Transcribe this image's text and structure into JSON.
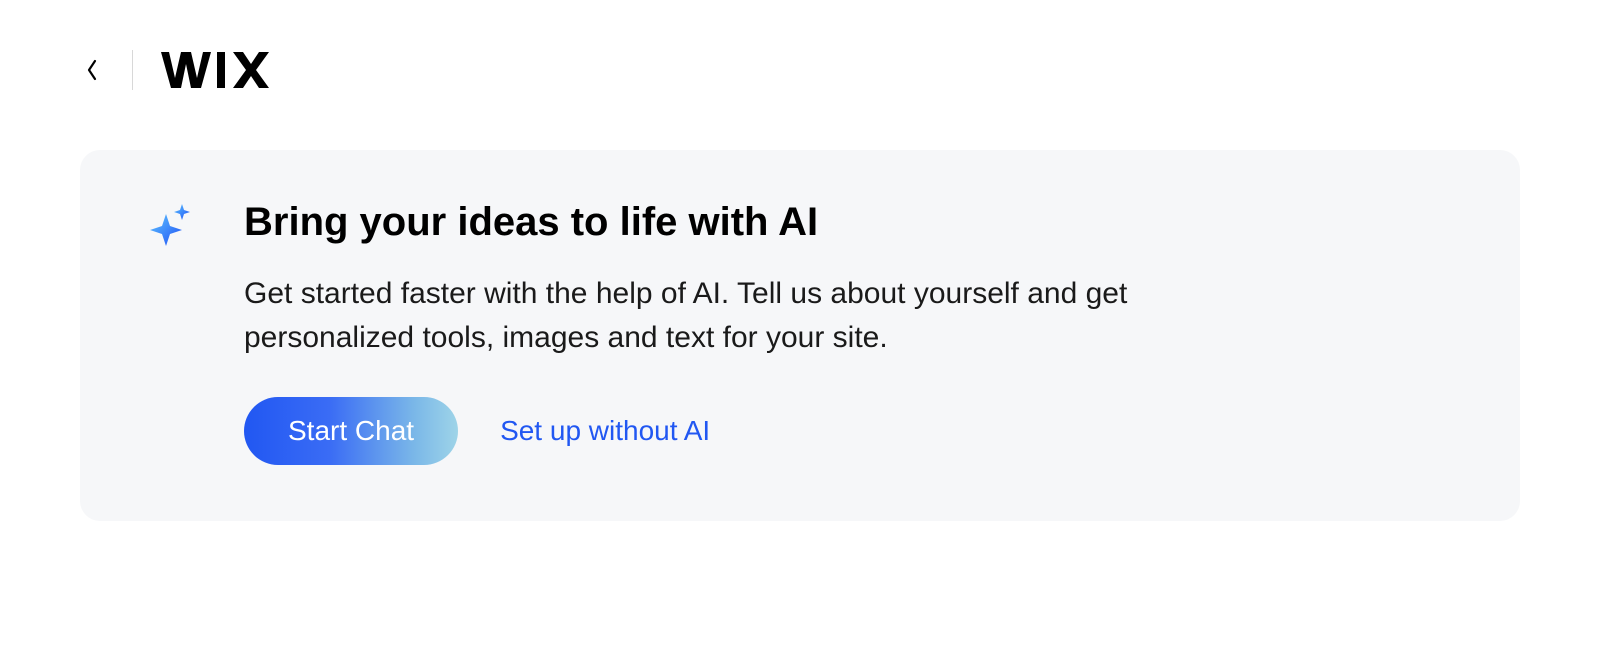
{
  "header": {
    "logo_text": "WIX"
  },
  "card": {
    "heading": "Bring your ideas to life with AI",
    "description": "Get started faster with the help of AI. Tell us about yourself and get personalized tools, images and text for your site.",
    "start_chat_label": "Start Chat",
    "setup_without_ai_label": "Set up without AI"
  },
  "colors": {
    "accent_blue": "#2157f2",
    "card_bg": "#f6f7f9"
  }
}
